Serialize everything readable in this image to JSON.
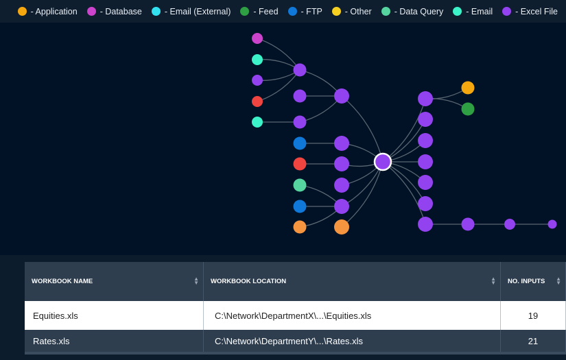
{
  "legend": [
    {
      "label": "- Application",
      "color": "#f5a70f"
    },
    {
      "label": "- Database",
      "color": "#cc44cc"
    },
    {
      "label": "- Email (External)",
      "color": "#33e0f0"
    },
    {
      "label": "- Feed",
      "color": "#2ea043"
    },
    {
      "label": "- FTP",
      "color": "#0f78d8"
    },
    {
      "label": "- Other",
      "color": "#f5d020"
    },
    {
      "label": "- Data Query",
      "color": "#55d4a0"
    },
    {
      "label": "- Email",
      "color": "#3cf2c8"
    },
    {
      "label": "- Excel File",
      "color": "#9342f0"
    }
  ],
  "colors": {
    "red": "#f04440",
    "orange": "#f6953f",
    "selected_border": "#ffffff",
    "edge": "#5a6672"
  },
  "graph": {
    "nodes": [
      {
        "id": "center",
        "type": "- Excel File",
        "selected": true
      },
      {
        "id": "a1",
        "type": "- Excel File"
      },
      {
        "id": "l1",
        "type": "- Database"
      },
      {
        "id": "l2",
        "type": "- Email"
      },
      {
        "id": "l3",
        "type": "- Excel File"
      },
      {
        "id": "l4",
        "type": "red"
      },
      {
        "id": "l5",
        "type": "- Email"
      },
      {
        "id": "a2",
        "type": "- Excel File"
      },
      {
        "id": "a3",
        "type": "- Excel File"
      },
      {
        "id": "b1",
        "type": "- Excel File"
      },
      {
        "id": "f1",
        "type": "- FTP"
      },
      {
        "id": "b2",
        "type": "- Excel File"
      },
      {
        "id": "r1",
        "type": "red"
      },
      {
        "id": "b3",
        "type": "- Excel File"
      },
      {
        "id": "q1",
        "type": "- Data Query"
      },
      {
        "id": "b4",
        "type": "- Excel File"
      },
      {
        "id": "f2",
        "type": "- FTP"
      },
      {
        "id": "b5",
        "type": "- Excel File"
      },
      {
        "id": "o1",
        "type": "orange"
      },
      {
        "id": "b6",
        "type": "orange"
      },
      {
        "id": "c1",
        "type": "- Excel File"
      },
      {
        "id": "ap",
        "type": "- Application"
      },
      {
        "id": "fd",
        "type": "- Feed"
      },
      {
        "id": "c2",
        "type": "- Excel File"
      },
      {
        "id": "c3",
        "type": "- Excel File"
      },
      {
        "id": "c4",
        "type": "- Excel File"
      },
      {
        "id": "c5",
        "type": "- Excel File"
      },
      {
        "id": "c6",
        "type": "- Excel File"
      },
      {
        "id": "c7",
        "type": "- Excel File"
      },
      {
        "id": "d1",
        "type": "- Excel File"
      },
      {
        "id": "d2",
        "type": "- Excel File"
      },
      {
        "id": "d3",
        "type": "- Excel File"
      }
    ],
    "edges": [
      [
        "l1",
        "a1"
      ],
      [
        "l2",
        "a1"
      ],
      [
        "l3",
        "a1"
      ],
      [
        "l4",
        "a1"
      ],
      [
        "l5",
        "a3"
      ],
      [
        "a1",
        "b1"
      ],
      [
        "a2",
        "b1"
      ],
      [
        "a3",
        "b1"
      ],
      [
        "b1",
        "center"
      ],
      [
        "f1",
        "b2"
      ],
      [
        "b2",
        "center"
      ],
      [
        "r1",
        "b3"
      ],
      [
        "b3",
        "center"
      ],
      [
        "q1",
        "b5"
      ],
      [
        "f2",
        "b5"
      ],
      [
        "o1",
        "b5"
      ],
      [
        "b4",
        "center"
      ],
      [
        "b5",
        "center"
      ],
      [
        "b6",
        "center"
      ],
      [
        "center",
        "c1"
      ],
      [
        "c1",
        "ap"
      ],
      [
        "c1",
        "fd"
      ],
      [
        "center",
        "c2"
      ],
      [
        "center",
        "c3"
      ],
      [
        "center",
        "c4"
      ],
      [
        "center",
        "c5"
      ],
      [
        "center",
        "c6"
      ],
      [
        "center",
        "c7"
      ],
      [
        "c7",
        "d1"
      ],
      [
        "d1",
        "d2"
      ],
      [
        "d2",
        "d3"
      ]
    ]
  },
  "table": {
    "columns": [
      "WORKBOOK NAME",
      "WORKBOOK LOCATION",
      "NO. INPUTS"
    ],
    "rows": [
      {
        "name": "Equities.xls",
        "location": "C:\\Network\\DepartmentX\\...\\Equities.xls",
        "inputs": "19"
      },
      {
        "name": "Rates.xls",
        "location": "C:\\Network\\DepartmentY\\...\\Rates.xls",
        "inputs": "21"
      }
    ]
  }
}
